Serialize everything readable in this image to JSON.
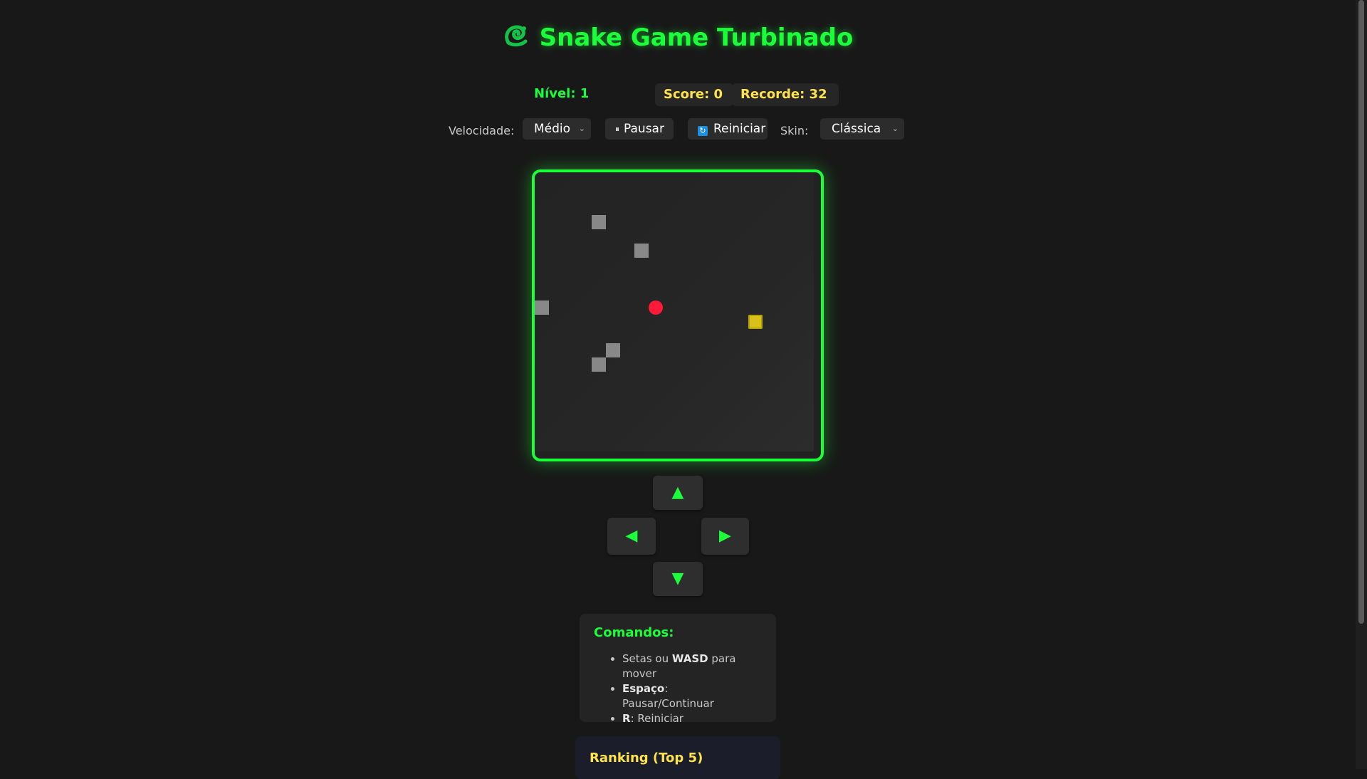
{
  "header": {
    "title": "Snake Game Turbinado",
    "logo_icon": "snake-icon"
  },
  "stats": {
    "level": "Nível: 1",
    "score": "Score: 0",
    "record": "Recorde: 32"
  },
  "controls": {
    "speed_label": "Velocidade:",
    "speed_value": "Médio",
    "pause_label": "Pausar",
    "restart_label": "Reiniciar",
    "skin_label": "Skin:",
    "skin_value": "Clássica"
  },
  "colors": {
    "accent": "#1aff3a",
    "score": "#ffe34d",
    "food": "#ff1a3a",
    "snake": "#d8c21a",
    "obstacle": "#888888"
  },
  "board": {
    "grid_size": 20,
    "obstacles": [
      [
        4,
        3
      ],
      [
        7,
        5
      ],
      [
        0,
        9
      ],
      [
        5,
        12
      ],
      [
        4,
        13
      ]
    ],
    "food": [
      8,
      9
    ],
    "snake": [
      [
        15,
        10
      ]
    ]
  },
  "dpad": {
    "up": "▲",
    "left": "◀",
    "right": "▶",
    "down": "▼"
  },
  "commands": {
    "title": "Comandos:",
    "items": [
      {
        "pre": "Setas ou ",
        "bold": "WASD",
        "post": " para mover"
      },
      {
        "pre": "",
        "bold": "Espaço",
        "post": ": Pausar/Continuar"
      },
      {
        "pre": "",
        "bold": "R",
        "post": ": Reiniciar"
      }
    ]
  },
  "ranking": {
    "title": "Ranking (Top 5)"
  }
}
